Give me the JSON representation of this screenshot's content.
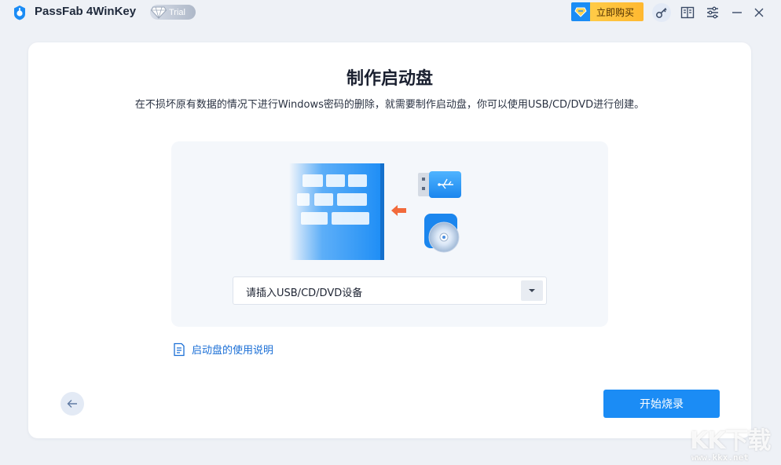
{
  "titlebar": {
    "app_name": "PassFab 4WinKey",
    "trial_label": "Trial",
    "buy_label": "立即购买",
    "icons": [
      "app-logo-icon",
      "diamond-icon",
      "cart-icon",
      "key-icon",
      "guide-book-icon",
      "settings-sliders-icon",
      "minimize-icon",
      "close-icon"
    ]
  },
  "main": {
    "title": "制作启动盘",
    "description": "在不损坏原有数据的情况下进行Windows密码的删除，就需要制作启动盘，你可以使用USB/CD/DVD进行创建。",
    "device_select": {
      "selected": "请插入USB/CD/DVD设备"
    },
    "guide_link": "启动盘的使用说明",
    "start_button": "开始烧录"
  },
  "watermark": {
    "text": "KK下载",
    "url": "www.kkx.net"
  },
  "colors": {
    "accent": "#1b8cf5",
    "link": "#1b6fd6",
    "buy_gold": "#ffc640",
    "arrow_orange": "#f26a3b",
    "background": "#eef1f6"
  }
}
